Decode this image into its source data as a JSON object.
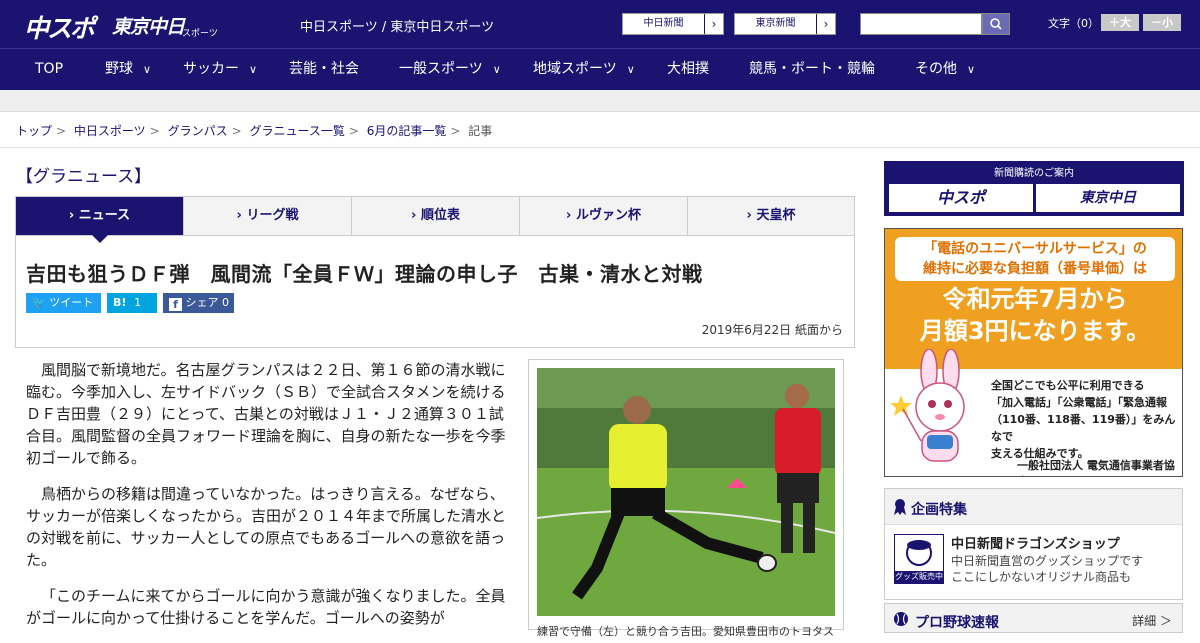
{
  "header": {
    "logo_main": "中スポ",
    "logo_tokyo": "東京中日",
    "logo_tokyo_sub": "スポーツ",
    "site_title": "中日スポーツ / 東京中日スポーツ",
    "site_buttons": [
      "中日新聞",
      "東京新聞"
    ],
    "search_placeholder": "",
    "font_size_label": "文字（0）",
    "font_larger": "＋大",
    "font_smaller": "－小"
  },
  "nav": {
    "items": [
      {
        "label": "TOP",
        "has_menu": false
      },
      {
        "label": "野球",
        "has_menu": true
      },
      {
        "label": "サッカー",
        "has_menu": true
      },
      {
        "label": "芸能・社会",
        "has_menu": false
      },
      {
        "label": "一般スポーツ",
        "has_menu": true
      },
      {
        "label": "地域スポーツ",
        "has_menu": true
      },
      {
        "label": "大相撲",
        "has_menu": false
      },
      {
        "label": "競馬・ボート・競輪",
        "has_menu": false
      },
      {
        "label": "その他",
        "has_menu": true
      }
    ]
  },
  "breadcrumb": [
    "トップ",
    "中日スポーツ",
    "グランパス",
    "グラニュース一覧",
    "6月の記事一覧",
    "記事"
  ],
  "section_title": "【グラニュース】",
  "tabs": [
    "ニュース",
    "リーグ戦",
    "順位表",
    "ルヴァン杯",
    "天皇杯"
  ],
  "active_tab": 0,
  "article": {
    "headline": "吉田も狙うＤＦ弾　風間流「全員ＦＷ」理論の申し子　古巣・清水と対戦",
    "share": {
      "tweet": "ツイート",
      "hatena": "B!",
      "hatena_count": "1",
      "facebook": "シェア",
      "facebook_count": "0"
    },
    "date": "2019年6月22日 紙面から",
    "paragraphs": [
      "風間脳で新境地だ。名古屋グランパスは２２日、第１６節の清水戦に臨む。今季加入し、左サイドバック（ＳＢ）で全試合スタメンを続けるＤＦ吉田豊（２９）にとって、古巣との対戦はＪ１・Ｊ２通算３０１試合目。風間監督の全員フォワード理論を胸に、自身の新たな一歩を今季初ゴールで飾る。",
      "鳥栖からの移籍は間違っていなかった。はっきり言える。なぜなら、サッカーが倍楽しくなったから。吉田が２０１４年まで所属した清水との対戦を前に、サッカー人としての原点でもあるゴールへの意欲を語った。",
      "「このチームに来てからゴールに向かう意識が強くなりました。全員がゴールに向かって仕掛けることを学んだ。ゴールへの姿勢が"
    ],
    "photo_caption": "練習で守備（左）と競り合う吉田。愛知県豊田市のトヨタスポーツセンター"
  },
  "sidebar": {
    "subscribe_title": "新聞購読のご案内",
    "subscribe_links": [
      "中スポ",
      "東京中日"
    ],
    "ad": {
      "head_line1": "「電話のユニバーサルサービス」の",
      "head_line2": "維持に必要な負担額（番号単価）は",
      "big_line1": "令和元年7月から",
      "big_line2": "月額3円になります。",
      "text_lines": [
        "全国どこでも公平に利用できる",
        "「加入電話」「公衆電話」「緊急通報",
        "（110番、118番、119番）」をみんなで",
        "支える仕組みです。"
      ],
      "org": "一般社団法人 電気通信事業者協会"
    },
    "kikaku": {
      "title": "企画特集",
      "item_title": "中日新聞ドラゴンズショップ",
      "item_desc1": "中日新聞直営のグッズショップです",
      "item_desc2": "ここにしかないオリジナル商品も",
      "thumb_label": "グッズ販売中"
    },
    "yakyu": {
      "title": "プロ野球速報",
      "more": "詳細 ＞"
    }
  },
  "colors": {
    "brand": "#1a1470",
    "twitter": "#1da1f2",
    "hatena": "#00a4de",
    "facebook": "#3b5998",
    "ad_orange": "#f0a020"
  }
}
